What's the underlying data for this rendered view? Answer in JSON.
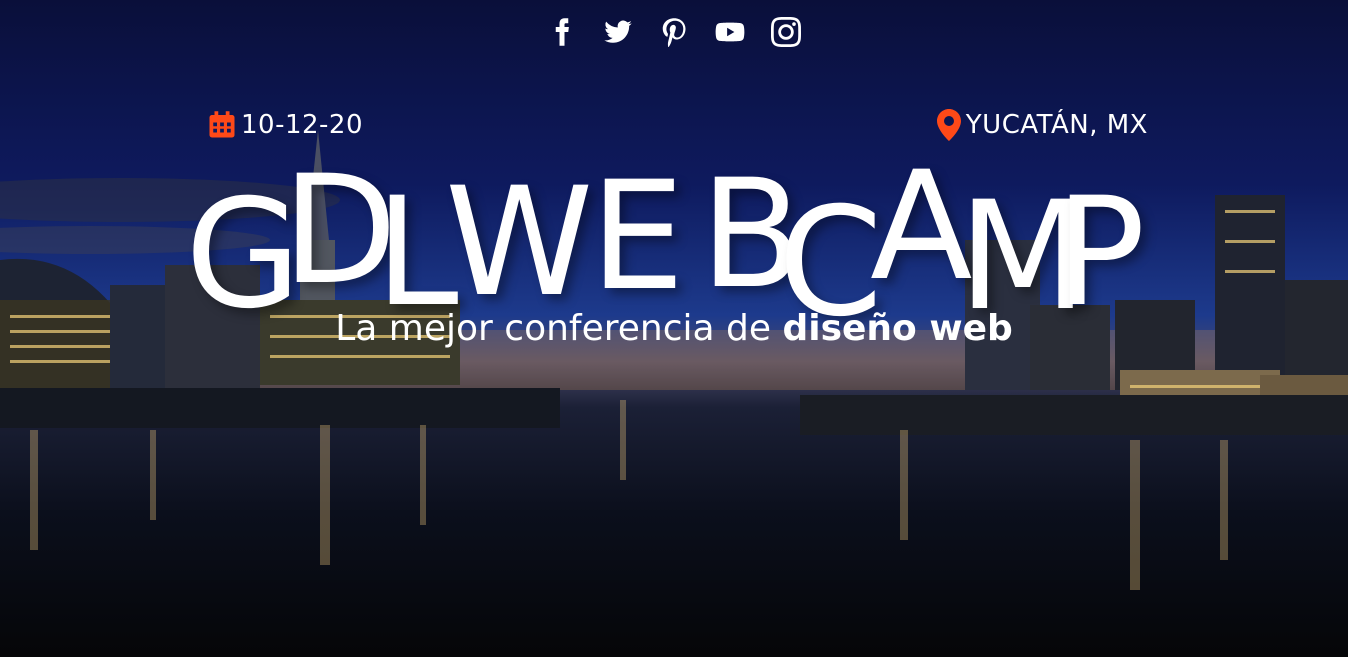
{
  "social": {
    "facebook": "facebook-icon",
    "twitter": "twitter-icon",
    "pinterest": "pinterest-icon",
    "youtube": "youtube-icon",
    "instagram": "instagram-icon"
  },
  "event": {
    "date": "10-12-20",
    "location": "YUCATÁN, MX"
  },
  "title_letters": [
    "G",
    "D",
    "L",
    "W",
    "E",
    "B",
    "C",
    "A",
    "M",
    "P"
  ],
  "subtitle": {
    "regular": "La mejor conferencia de ",
    "bold": "diseño web"
  },
  "colors": {
    "accent": "#fe4918",
    "text": "#ffffff"
  }
}
